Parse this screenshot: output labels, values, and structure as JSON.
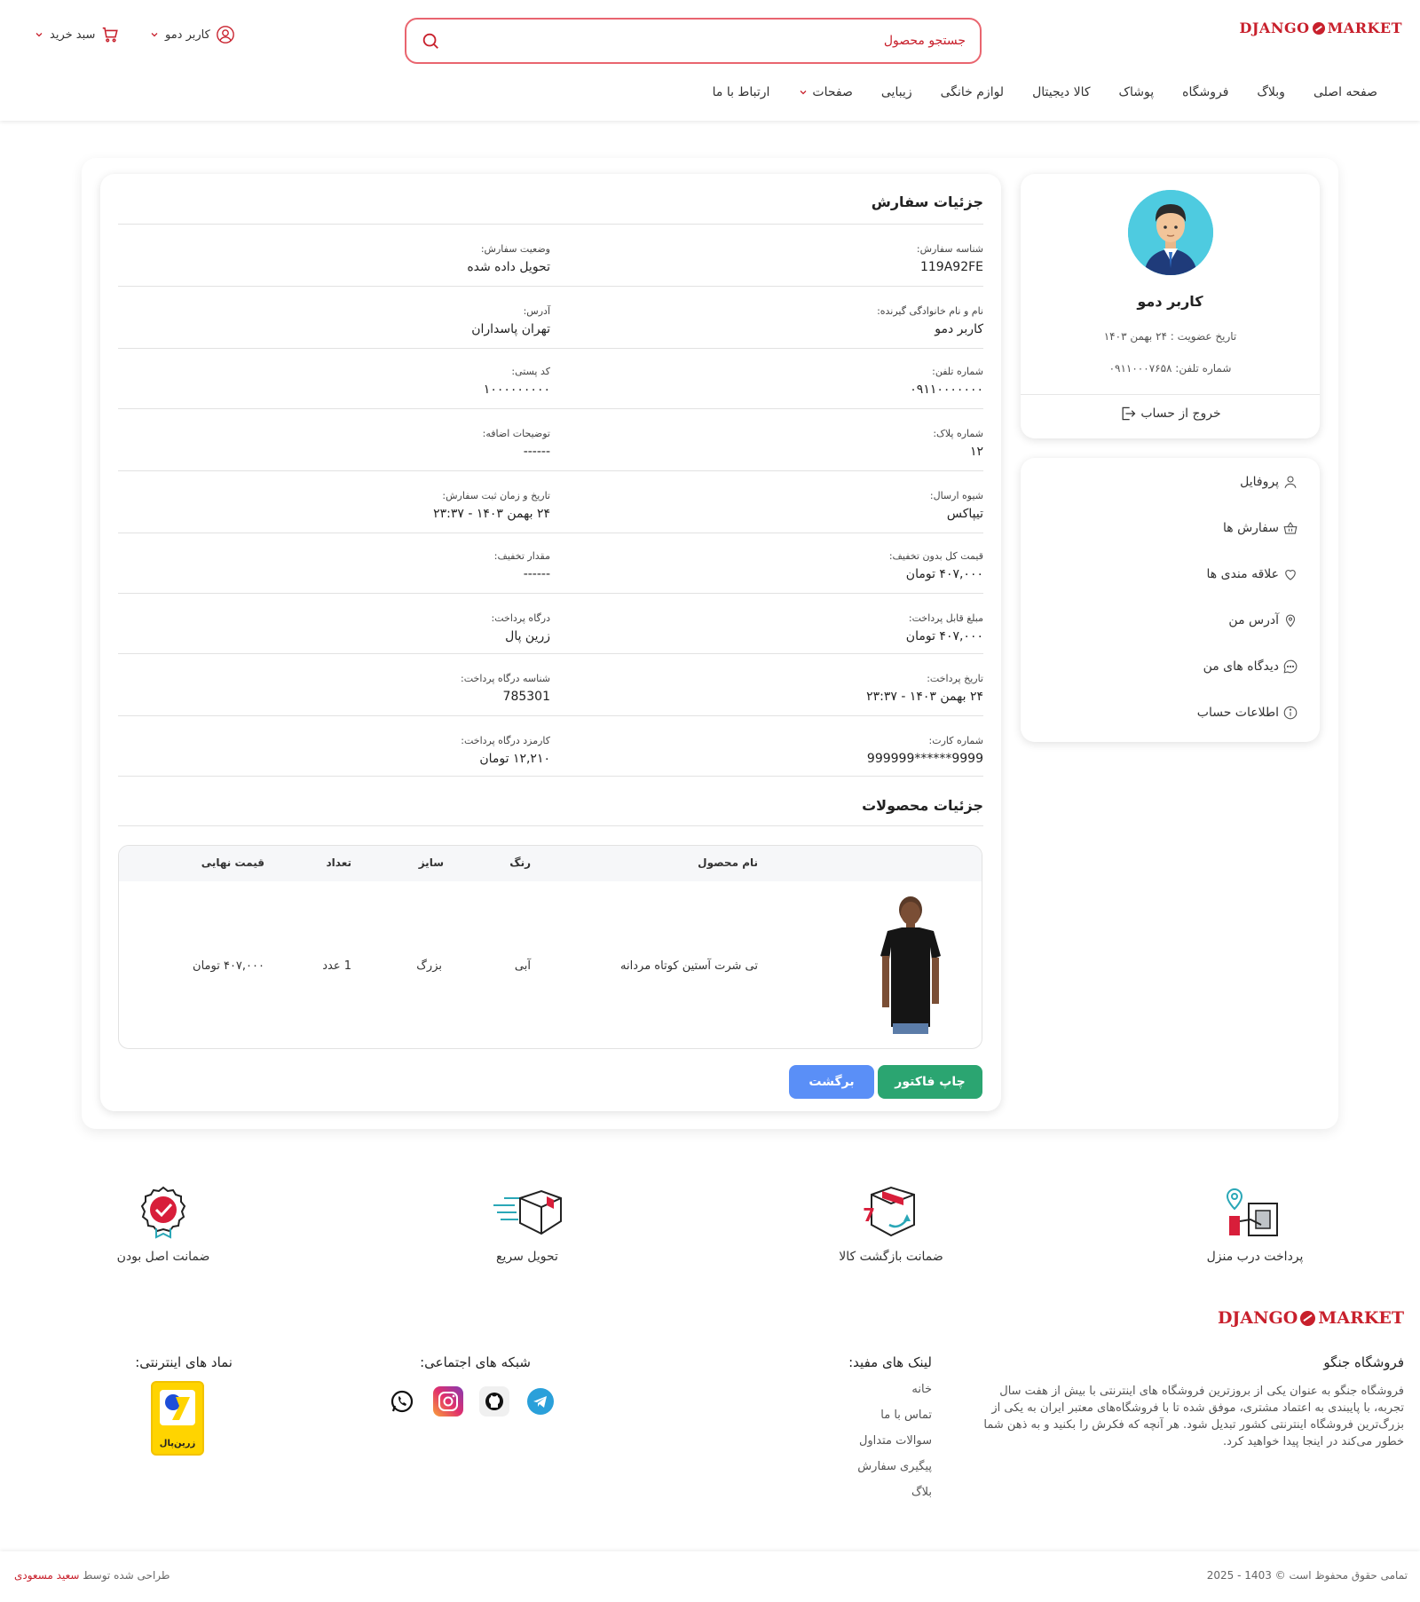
{
  "brand": {
    "logo_left": "DJANGO",
    "logo_right": "MARKET",
    "accent": "#c8202c"
  },
  "header": {
    "search_placeholder": "جستجو محصول",
    "user_label": "کاربر دمو",
    "cart_label": "سبد خرید"
  },
  "nav": {
    "items": [
      "صفحه اصلی",
      "وبلاگ",
      "فروشگاه",
      "پوشاک",
      "کالا دیجیتال",
      "لوازم خانگی",
      "زیبایی",
      "صفحات",
      "ارتباط با ما"
    ]
  },
  "profile": {
    "name": "کاربر دمو",
    "member_since": "تاریخ عضویت : ۲۴ بهمن ۱۴۰۳",
    "phone": "شماره تلفن: ۰۹۱۱۰۰۰۷۶۵۸",
    "logout": "خروج از حساب"
  },
  "menu": {
    "items": [
      "پروفایل",
      "سفارش ها",
      "علاقه مندی ها",
      "آدرس من",
      "دیدگاه های من",
      "اطلاعات حساب"
    ]
  },
  "order": {
    "title": "جزئیات سفارش",
    "fields": [
      {
        "label": "شناسه سفارش:",
        "value": "119A92FE"
      },
      {
        "label": "وضعیت سفارش:",
        "value": "تحویل داده شده"
      },
      {
        "label": "نام و نام خانوادگی گیرنده:",
        "value": "کاربر دمو"
      },
      {
        "label": "آدرس:",
        "value": "تهران پاسداران"
      },
      {
        "label": "شماره تلفن:",
        "value": "۰۹۱۱۰۰۰۰۰۰۰"
      },
      {
        "label": "کد پستی:",
        "value": "۱۰۰۰۰۰۰۰۰۰"
      },
      {
        "label": "شماره پلاک:",
        "value": "۱۲"
      },
      {
        "label": "توضیحات اضافه:",
        "value": "------"
      },
      {
        "label": "شیوه ارسال:",
        "value": "تیپاکس"
      },
      {
        "label": "تاریخ و زمان ثبت سفارش:",
        "value": "۲۴ بهمن ۱۴۰۳ - ۲۳:۳۷"
      },
      {
        "label": "قیمت کل بدون تخفیف:",
        "value": "۴۰۷,۰۰۰ تومان"
      },
      {
        "label": "مقدار تخفیف:",
        "value": "------"
      },
      {
        "label": "مبلغ قابل پرداخت:",
        "value": "۴۰۷,۰۰۰ تومان"
      },
      {
        "label": "درگاه پرداخت:",
        "value": "زرین پال"
      },
      {
        "label": "تاریخ پرداخت:",
        "value": "۲۴ بهمن ۱۴۰۳ - ۲۳:۳۷"
      },
      {
        "label": "شناسه درگاه پرداخت:",
        "value": "785301"
      },
      {
        "label": "شماره کارت:",
        "value": "9999******999999"
      },
      {
        "label": "کارمزد درگاه پرداخت:",
        "value": "۱۲,۲۱۰ تومان"
      }
    ],
    "products_title": "جزئیات محصولات",
    "table_headers": {
      "name": "نام محصول",
      "color": "رنگ",
      "size": "سایز",
      "qty": "تعداد",
      "final_price": "قیمت نهایی"
    },
    "products": [
      {
        "name": "تی شرت آستین کوتاه مردانه",
        "color": "آبی",
        "size": "بزرگ",
        "qty": "1 عدد",
        "final_price": "۴۰۷,۰۰۰ تومان"
      }
    ],
    "print_button": "چاپ فاکتور",
    "back_button": "برگشت"
  },
  "features": [
    "پرداخت درب منزل",
    "ضمانت بازگشت کالا",
    "تحویل سریع",
    "ضمانت اصل بودن"
  ],
  "footer": {
    "about_title": "فروشگاه جنگو",
    "about_text": "فروشگاه جنگو به عنوان یکی از بروزترین فروشگاه های اینترنتی با بیش از هفت سال تجربه، با پایبندی به اعتماد مشتری، موفق شده تا با فروشگاه‌های معتبر ایران به یکی از بزرگ‌ترین فروشگاه اینترنتی کشور تبدیل شود. هر آنچه که فکرش را بکنید و به ذهن شما خطور می‌کند در اینجا پیدا خواهید کرد.",
    "links_title": "لینک های مفید:",
    "links": [
      "خانه",
      "تماس با ما",
      "سوالات متداول",
      "پیگیری سفارش",
      "بلاگ"
    ],
    "social_title": "شبکه های اجتماعی:",
    "socials": [
      "whatsapp-icon",
      "instagram-icon",
      "github-icon",
      "telegram-icon"
    ],
    "trust_title": "نماد های اینترنتی:",
    "trust_badge_text": "زرین‌پال",
    "copyright": "تمامی حقوق محفوظ است © 1403 - 2025",
    "designed_prefix": "طراحی شده توسط",
    "designed_author": "سعید مسعودی"
  }
}
